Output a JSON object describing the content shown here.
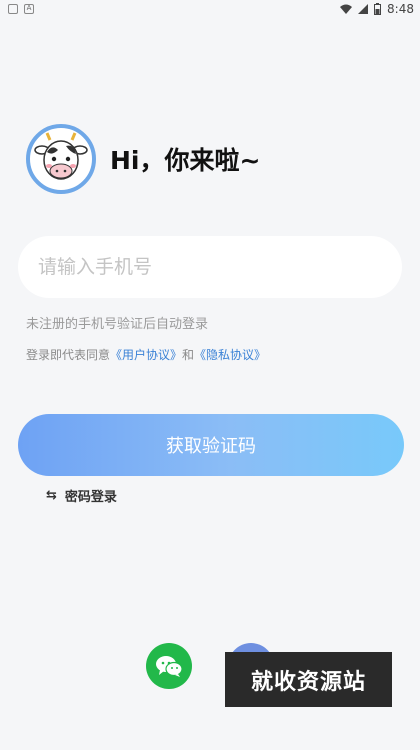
{
  "status_bar": {
    "time": "8:48"
  },
  "greeting": {
    "text": "Hi，你来啦~"
  },
  "phone": {
    "placeholder": "请输入手机号",
    "value": ""
  },
  "hint": "未注册的手机号验证后自动登录",
  "agreement": {
    "prefix": "登录即代表同意",
    "user_agreement": "《用户协议》",
    "conjunction": "和",
    "privacy_policy": "《隐私协议》"
  },
  "buttons": {
    "get_code": "获取验证码",
    "password_login": "密码登录"
  },
  "icons": {
    "swap": "swap-icon",
    "wechat": "wechat-icon"
  },
  "colors": {
    "accent": "#6ea2f4",
    "link": "#3b82d6",
    "wechat": "#22b84a"
  },
  "watermark": "就收资源站"
}
